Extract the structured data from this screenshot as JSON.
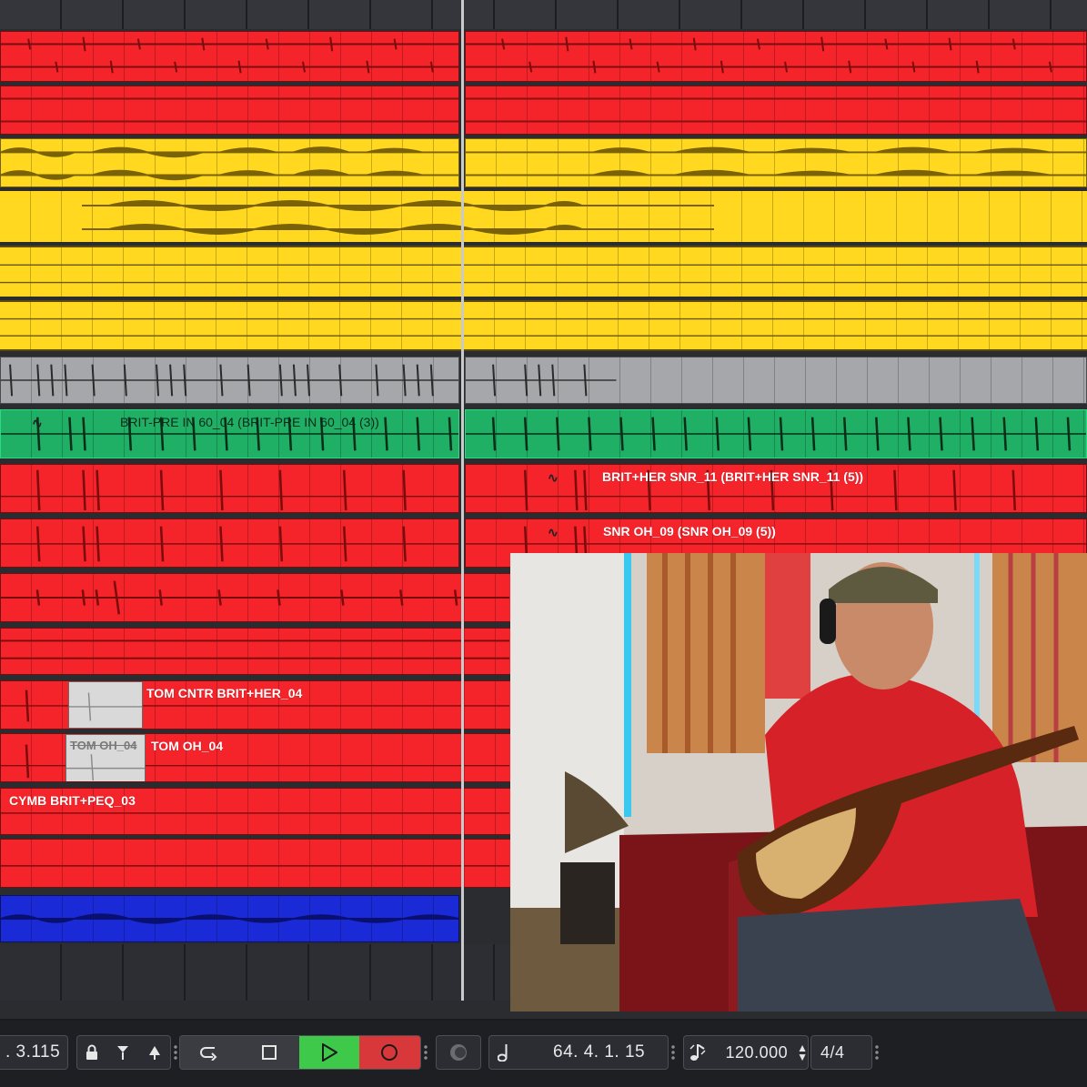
{
  "clips": {
    "green": "BRIT-PRE IN 60_04 (BRIT-PRE IN 60_04 (3))",
    "snare1": "BRIT+HER SNR_11 (BRIT+HER SNR_11 (5))",
    "snare2": "SNR OH_09 (SNR OH_09 (5))",
    "tom_cntr": "TOM CNTR BRIT+HER_04",
    "tom_oh_ghost": "TOM OH_04",
    "tom_oh": "TOM OH_04",
    "cymb": "CYMB BRIT+PEQ_03"
  },
  "transport": {
    "time_display": ". 3.115",
    "lock_icon": "lock-icon",
    "loop_icon": "loop-icon",
    "stop_icon": "stop-icon",
    "play_icon": "play-icon",
    "record_icon": "record-icon",
    "position": "64.  4.  1.  15",
    "tempo": "120.000",
    "signature": "4/4"
  },
  "colors": {
    "red": "#f5232a",
    "yellow": "#ffd81f",
    "gray": "#a5a7aa",
    "green": "#1fb066",
    "blue": "#1a2ad6",
    "play_active": "#3ec94a",
    "record": "#d8383a"
  }
}
